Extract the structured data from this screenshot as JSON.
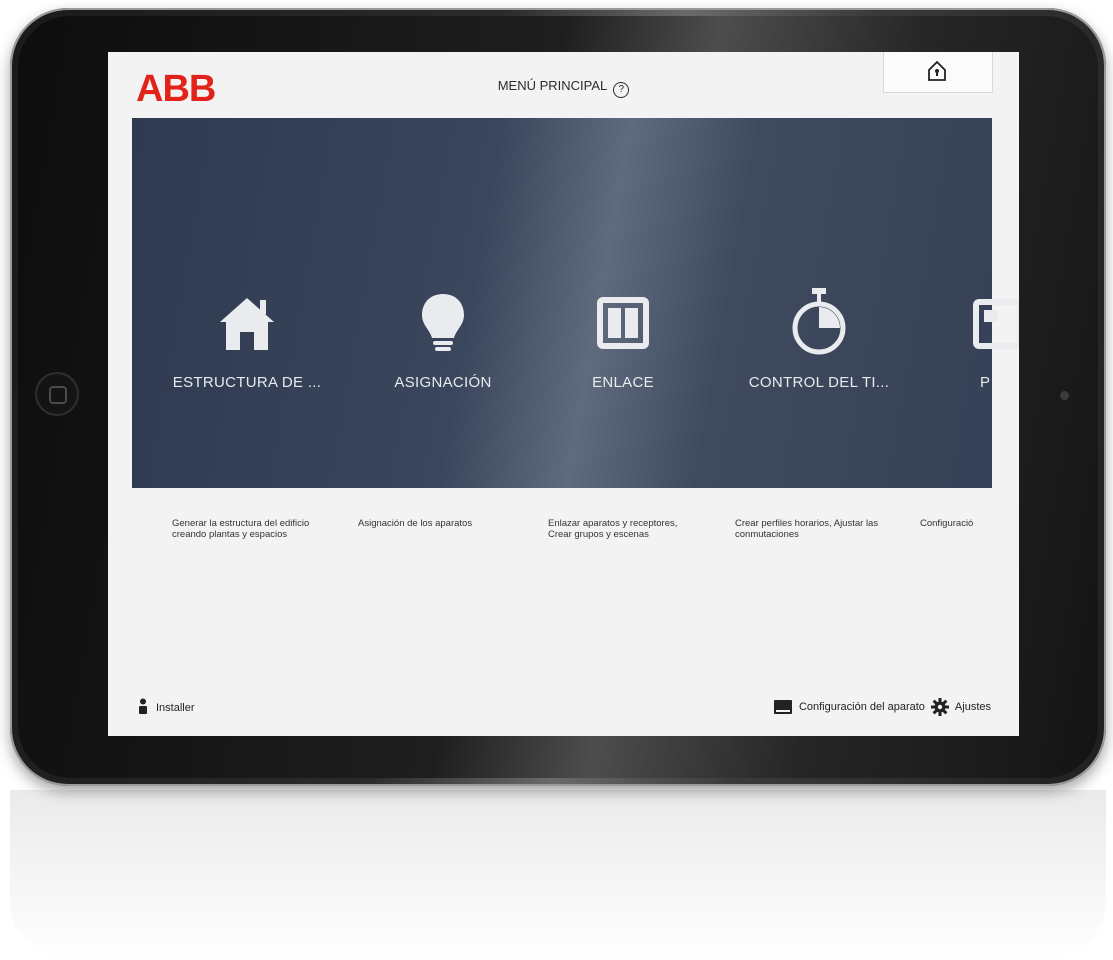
{
  "header": {
    "logo": "ABB",
    "title": "MENÚ PRINCIPAL",
    "help_glyph": "?"
  },
  "tiles": [
    {
      "label": "ESTRUCTURA DE ...",
      "icon": "house-icon",
      "description": "Generar la estructura del edificio creando plantas y espacios"
    },
    {
      "label": "ASIGNACIÓN",
      "icon": "lightbulb-icon",
      "description": "Asignación de los aparatos"
    },
    {
      "label": "ENLACE",
      "icon": "switch-icon",
      "description": "Enlazar aparatos y receptores, Crear grupos y escenas"
    },
    {
      "label": "CONTROL DEL TI...",
      "icon": "stopwatch-icon",
      "description": "Crear perfiles horarios, Ajustar las conmutaciones"
    },
    {
      "label": "P",
      "icon": "panel-icon",
      "description": "Configuració"
    }
  ],
  "footer": {
    "user_label": "Installer",
    "device_config_label": "Configuración del aparato",
    "settings_label": "Ajustes"
  },
  "colors": {
    "brand": "#e2231a",
    "panel": "#3a465c",
    "screen_bg": "#f3f3f4"
  }
}
